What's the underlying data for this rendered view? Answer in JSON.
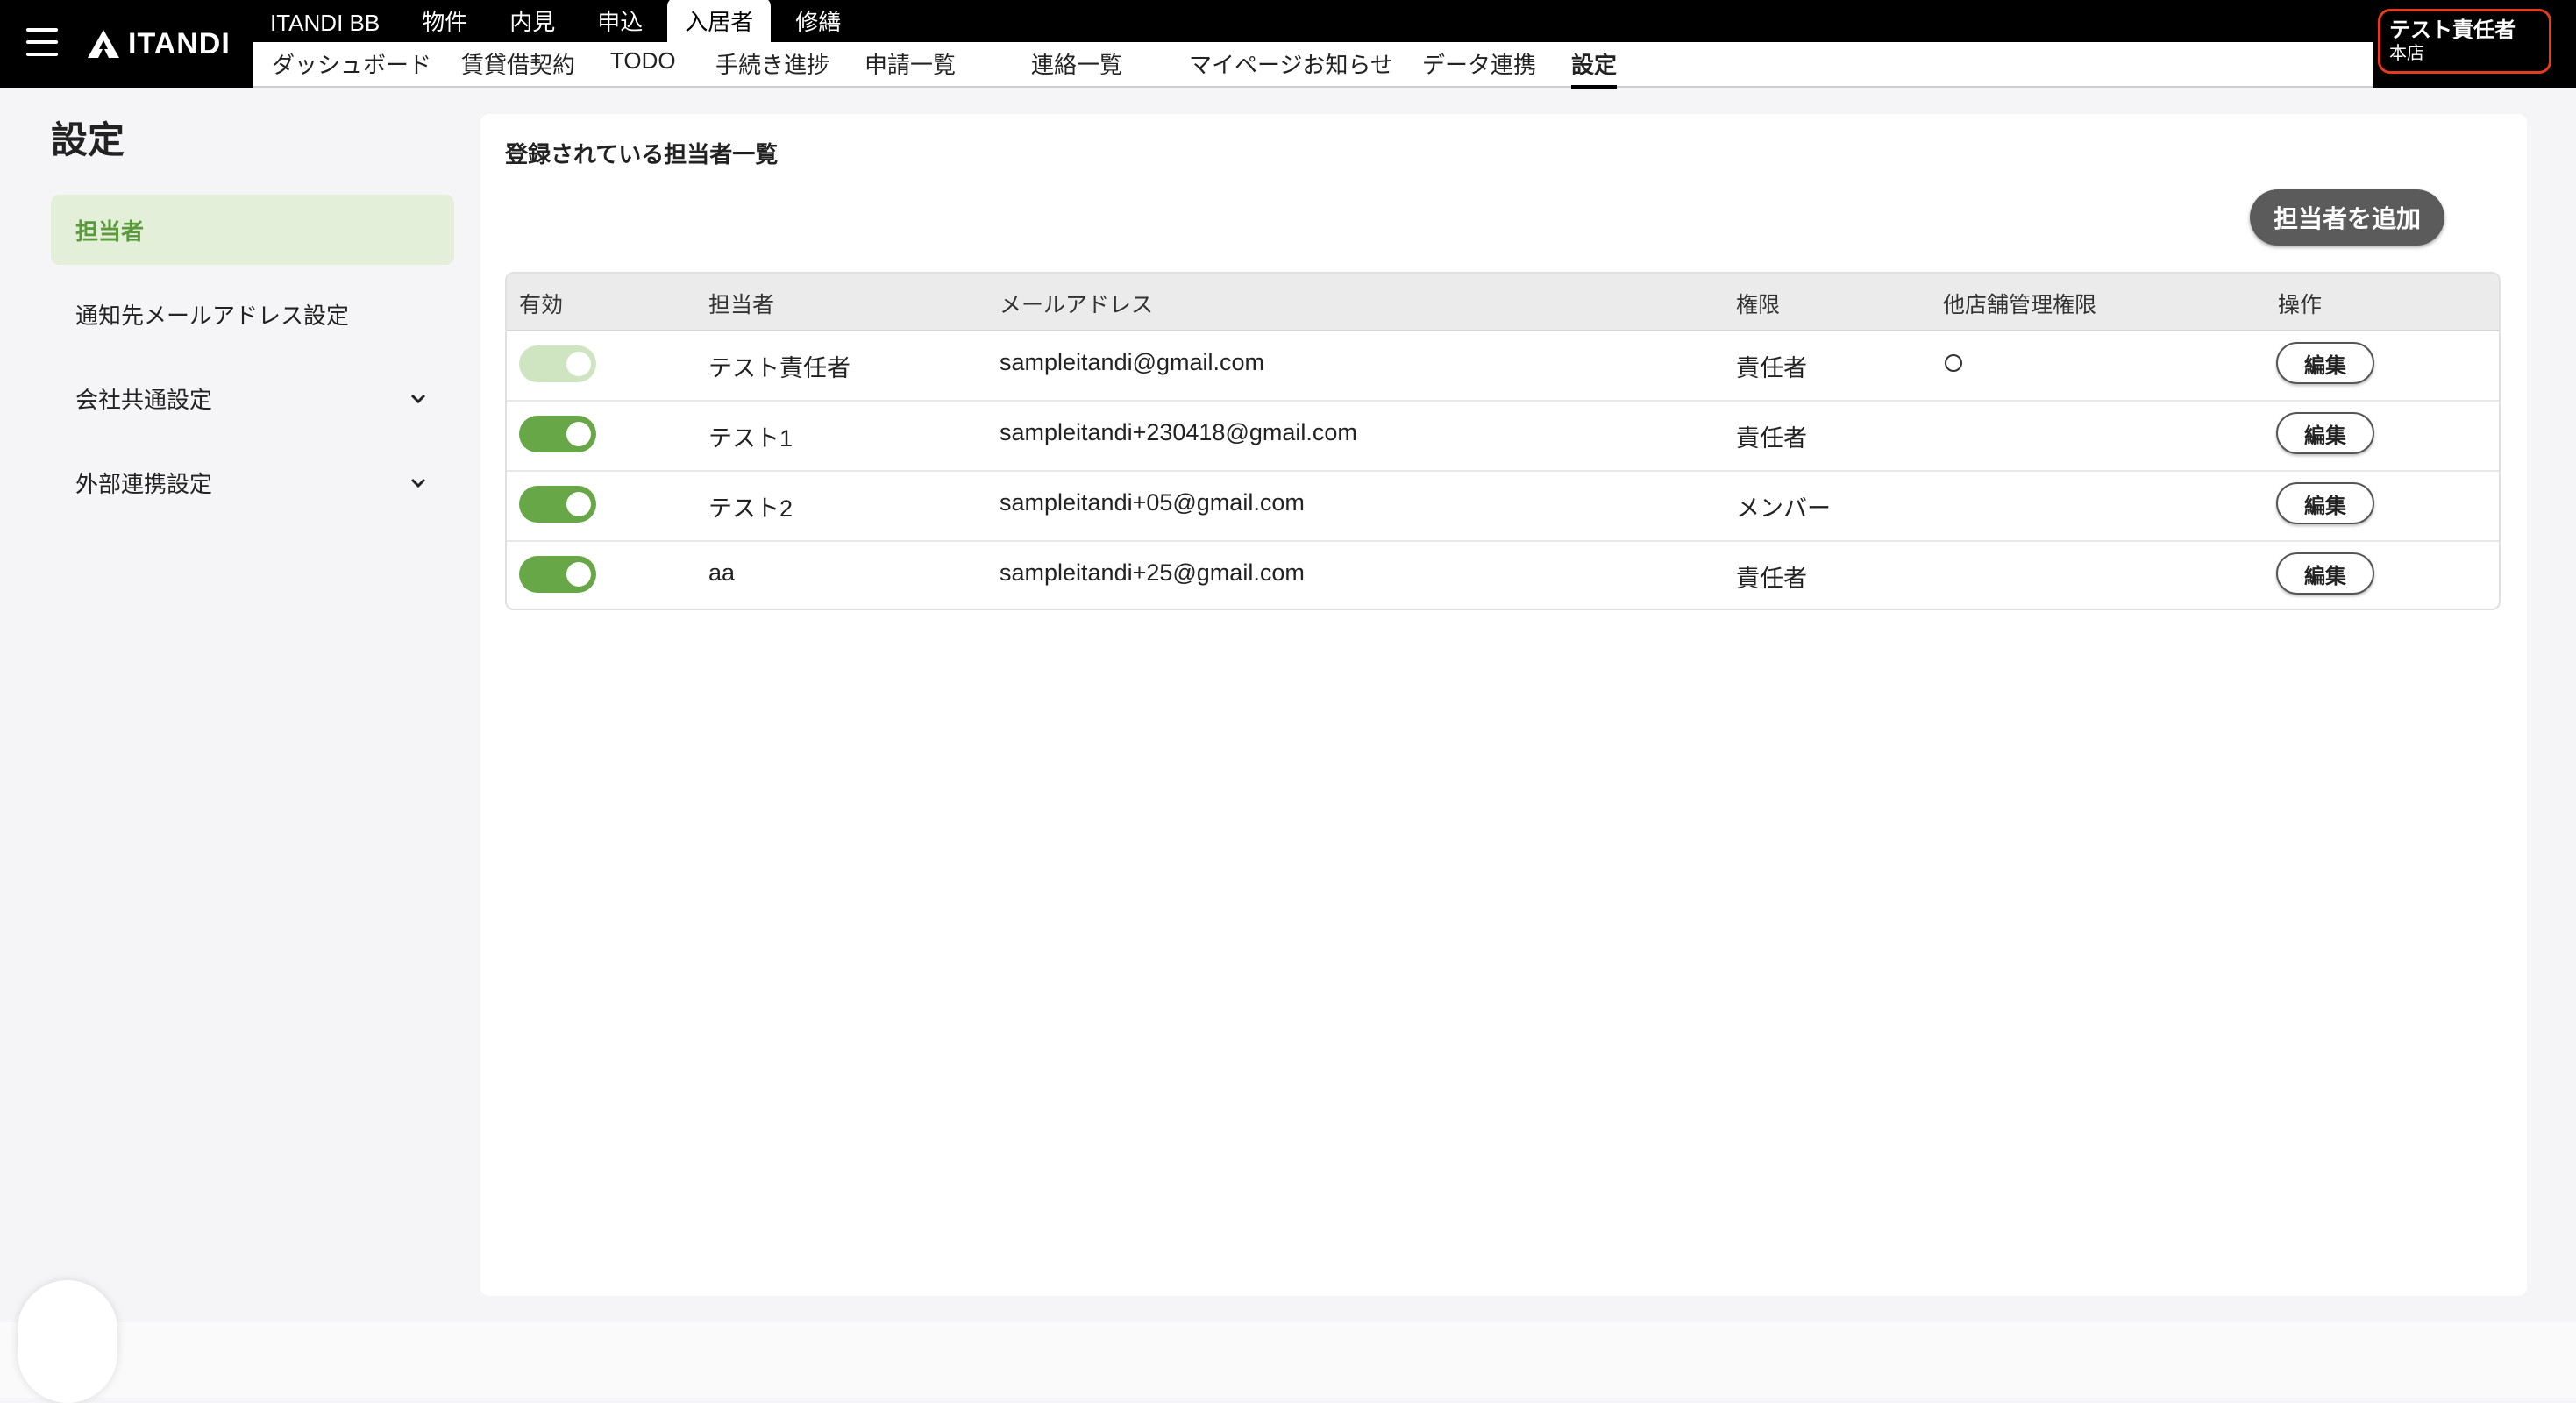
{
  "header": {
    "logo_text": "ITANDI",
    "top_tabs": [
      {
        "label": "ITANDI BB",
        "active": false
      },
      {
        "label": "物件",
        "active": false
      },
      {
        "label": "内見",
        "active": false
      },
      {
        "label": "申込",
        "active": false
      },
      {
        "label": "入居者",
        "active": true
      },
      {
        "label": "修繕",
        "active": false
      }
    ],
    "sub_nav": [
      {
        "label": "ダッシュボード"
      },
      {
        "label": "賃貸借契約"
      },
      {
        "label": "TODO"
      },
      {
        "label": "手続き進捗"
      },
      {
        "label": "申請一覧"
      },
      {
        "label": "連絡一覧"
      },
      {
        "label": "マイページお知らせ"
      },
      {
        "label": "データ連携"
      },
      {
        "label": "設定",
        "active": true
      }
    ],
    "user": {
      "name": "テスト責任者",
      "store": "本店"
    }
  },
  "sidebar": {
    "title": "設定",
    "items": [
      {
        "label": "担当者",
        "active": true
      },
      {
        "label": "通知先メールアドレス設定"
      },
      {
        "label": "会社共通設定",
        "expandable": true
      },
      {
        "label": "外部連携設定",
        "expandable": true
      }
    ]
  },
  "main": {
    "title": "登録されている担当者一覧",
    "add_button": "担当者を追加",
    "columns": [
      "有効",
      "担当者",
      "メールアドレス",
      "権限",
      "他店舗管理権限",
      "操作"
    ],
    "rows": [
      {
        "enabled": true,
        "toggle_disabled": true,
        "name": "テスト責任者",
        "email": "sampleitandi@gmail.com",
        "role": "責任者",
        "multi_store": "○",
        "action": "編集"
      },
      {
        "enabled": true,
        "toggle_disabled": false,
        "name": "テスト1",
        "email": "sampleitandi+230418@gmail.com",
        "role": "責任者",
        "multi_store": "",
        "action": "編集"
      },
      {
        "enabled": true,
        "toggle_disabled": false,
        "name": "テスト2",
        "email": "sampleitandi+05@gmail.com",
        "role": "メンバー",
        "multi_store": "",
        "action": "編集"
      },
      {
        "enabled": true,
        "toggle_disabled": false,
        "name": "aa",
        "email": "sampleitandi+25@gmail.com",
        "role": "責任者",
        "multi_store": "",
        "action": "編集"
      }
    ]
  },
  "colors": {
    "accent_green": "#67a747",
    "active_bg": "#e3efd9",
    "user_outline": "#e33c1e",
    "header_bg": "#000000"
  }
}
